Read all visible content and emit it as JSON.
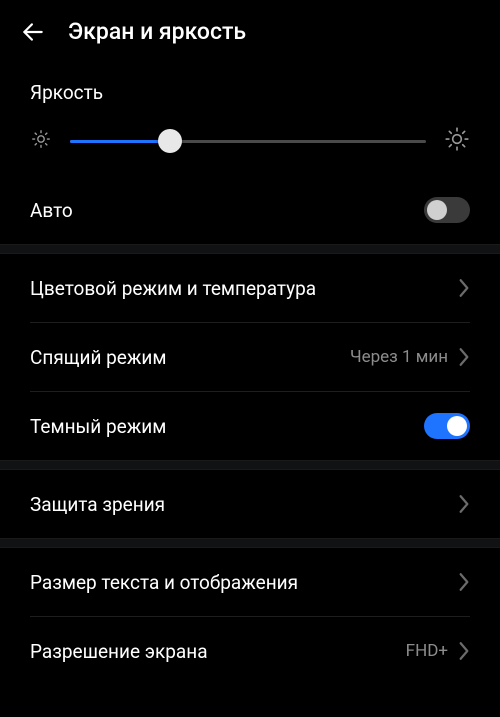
{
  "header": {
    "title": "Экран и яркость"
  },
  "brightness": {
    "label": "Яркость",
    "value_percent": 28
  },
  "auto": {
    "label": "Авто",
    "enabled": false
  },
  "color_mode": {
    "label": "Цветовой режим и температура"
  },
  "sleep": {
    "label": "Спящий режим",
    "value": "Через 1 мин"
  },
  "dark_mode": {
    "label": "Темный режим",
    "enabled": true
  },
  "eye_comfort": {
    "label": "Защита зрения"
  },
  "text_size": {
    "label": "Размер текста и отображения"
  },
  "resolution": {
    "label": "Разрешение экрана",
    "value": "FHD+"
  },
  "icons": {
    "back": "arrow-left",
    "sun_small": "brightness-low",
    "sun_large": "brightness-high",
    "chevron": "chevron-right"
  }
}
